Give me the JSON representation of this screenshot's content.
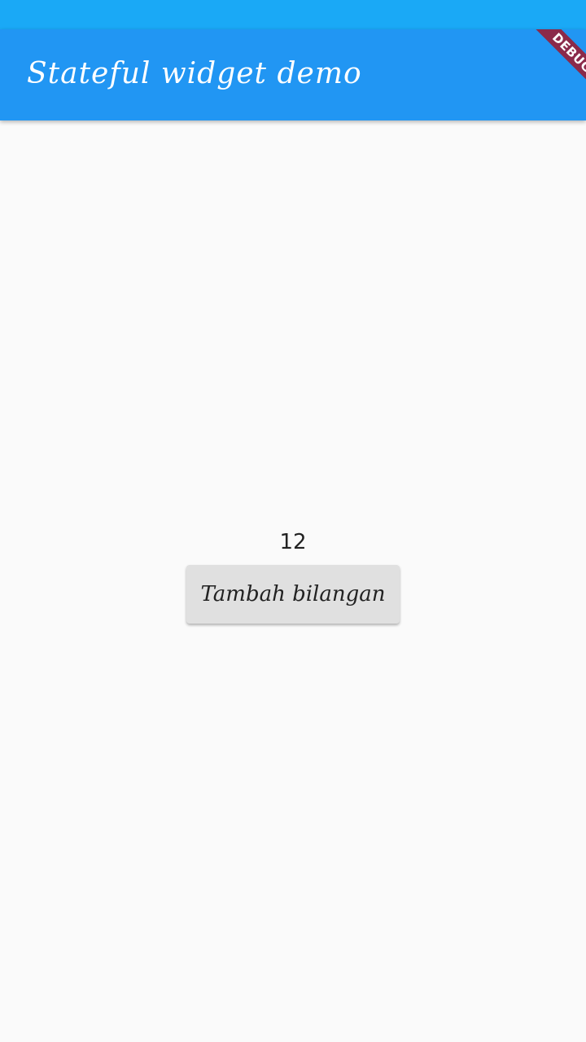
{
  "app_bar": {
    "title": "Stateful widget demo",
    "background_color": "#2196f3",
    "status_bar_color": "#1aa9f6"
  },
  "debug_banner": {
    "label": "DEBUG",
    "color": "#8b2a4a"
  },
  "main": {
    "counter_value": "12",
    "increment_button_label": "Tambah bilangan"
  }
}
